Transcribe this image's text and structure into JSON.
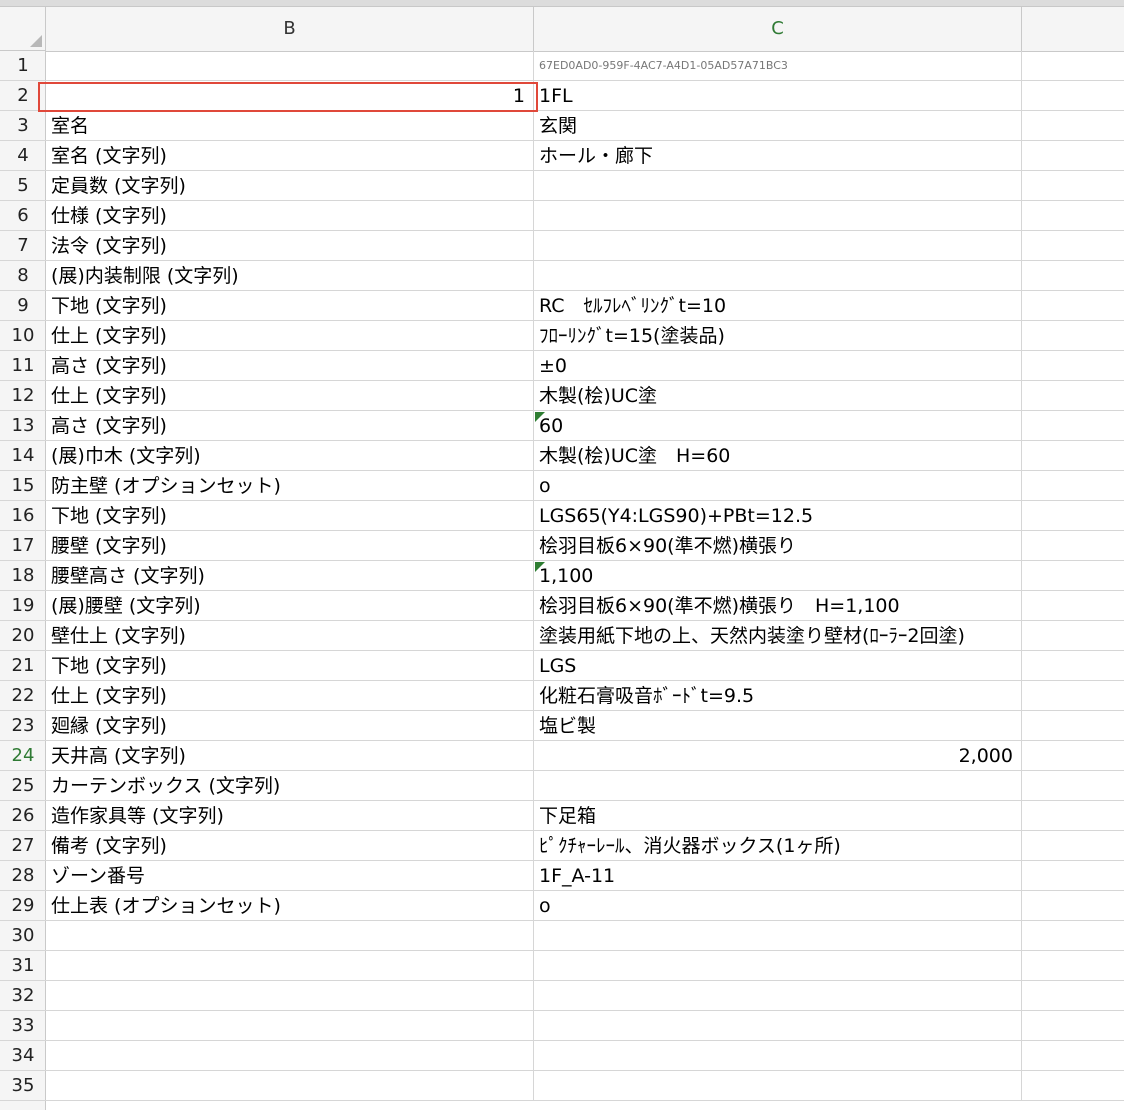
{
  "columns": {
    "b": "B",
    "c": "C"
  },
  "rows": [
    {
      "n": "1",
      "b": "",
      "c": "67ED0AD0-959F-4AC7-A4D1-05AD57A71BC3"
    },
    {
      "n": "2",
      "b": "1",
      "c": "1FL"
    },
    {
      "n": "3",
      "b": "室名",
      "c": "玄関"
    },
    {
      "n": "4",
      "b": "室名 (文字列)",
      "c": "ホール・廊下"
    },
    {
      "n": "5",
      "b": "定員数 (文字列)",
      "c": ""
    },
    {
      "n": "6",
      "b": "仕様 (文字列)",
      "c": ""
    },
    {
      "n": "7",
      "b": "法令 (文字列)",
      "c": ""
    },
    {
      "n": "8",
      "b": "(展)内装制限 (文字列)",
      "c": ""
    },
    {
      "n": "9",
      "b": "下地 (文字列)",
      "c": "RC　ｾﾙﾌﾚﾍﾞﾘﾝｸﾞt=10"
    },
    {
      "n": "10",
      "b": "仕上 (文字列)",
      "c": "ﾌﾛｰﾘﾝｸﾞt=15(塗装品)"
    },
    {
      "n": "11",
      "b": "高さ (文字列)",
      "c": "±0"
    },
    {
      "n": "12",
      "b": "仕上 (文字列)",
      "c": "木製(桧)UC塗"
    },
    {
      "n": "13",
      "b": "高さ (文字列)",
      "c": "60"
    },
    {
      "n": "14",
      "b": "(展)巾木 (文字列)",
      "c": "木製(桧)UC塗　H=60"
    },
    {
      "n": "15",
      "b": "防主壁 (オプションセット)",
      "c": "o"
    },
    {
      "n": "16",
      "b": "下地 (文字列)",
      "c": "LGS65(Y4:LGS90)+PBt=12.5"
    },
    {
      "n": "17",
      "b": "腰壁 (文字列)",
      "c": "桧羽目板6×90(準不燃)横張り"
    },
    {
      "n": "18",
      "b": "腰壁高さ (文字列)",
      "c": "1,100"
    },
    {
      "n": "19",
      "b": "(展)腰壁 (文字列)",
      "c": "桧羽目板6×90(準不燃)横張り　H=1,100"
    },
    {
      "n": "20",
      "b": "壁仕上 (文字列)",
      "c": "塗装用紙下地の上、天然内装塗り壁材(ﾛｰﾗｰ2回塗)"
    },
    {
      "n": "21",
      "b": "下地 (文字列)",
      "c": "LGS"
    },
    {
      "n": "22",
      "b": "仕上 (文字列)",
      "c": "化粧石膏吸音ﾎﾞｰﾄﾞt=9.5"
    },
    {
      "n": "23",
      "b": "廻縁 (文字列)",
      "c": "塩ビ製"
    },
    {
      "n": "24",
      "b": "天井高 (文字列)",
      "c": "2,000"
    },
    {
      "n": "25",
      "b": "カーテンボックス (文字列)",
      "c": ""
    },
    {
      "n": "26",
      "b": "造作家具等 (文字列)",
      "c": "下足箱"
    },
    {
      "n": "27",
      "b": "備考 (文字列)",
      "c": "ﾋﾟｸﾁｬｰﾚｰﾙ、消火器ボックス(1ヶ所)"
    },
    {
      "n": "28",
      "b": "ゾーン番号",
      "c": "1F_A-11"
    },
    {
      "n": "29",
      "b": "仕上表 (オプションセット)",
      "c": "o"
    },
    {
      "n": "30",
      "b": "",
      "c": ""
    },
    {
      "n": "31",
      "b": "",
      "c": ""
    },
    {
      "n": "32",
      "b": "",
      "c": ""
    },
    {
      "n": "33",
      "b": "",
      "c": ""
    },
    {
      "n": "34",
      "b": "",
      "c": ""
    },
    {
      "n": "35",
      "b": "",
      "c": ""
    }
  ]
}
